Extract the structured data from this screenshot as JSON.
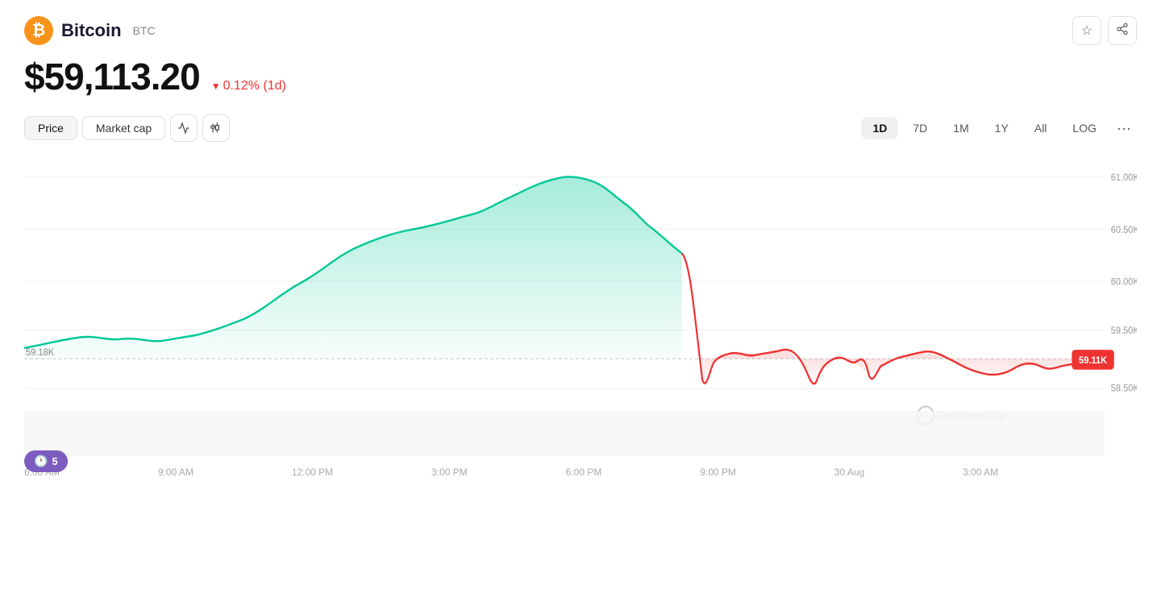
{
  "header": {
    "coin_name": "Bitcoin",
    "coin_symbol": "BTC",
    "price": "$59,113.20",
    "change": "0.12% (1d)",
    "change_direction": "down"
  },
  "tabs": {
    "price_label": "Price",
    "market_cap_label": "Market cap"
  },
  "time_filters": [
    {
      "label": "1D",
      "active": true
    },
    {
      "label": "7D",
      "active": false
    },
    {
      "label": "1M",
      "active": false
    },
    {
      "label": "1Y",
      "active": false
    },
    {
      "label": "All",
      "active": false
    },
    {
      "label": "LOG",
      "active": false
    }
  ],
  "chart": {
    "open_price": "59.18K",
    "current_price": "59.11K",
    "y_labels": [
      "61.00K",
      "60.50K",
      "60.00K",
      "59.50K",
      "59.18K",
      "58.50K"
    ],
    "x_labels": [
      "6:00 AM",
      "9:00 AM",
      "12:00 PM",
      "3:00 PM",
      "6:00 PM",
      "9:00 PM",
      "30 Aug",
      "3:00 AM"
    ]
  },
  "watermark": "CoinMarketCap",
  "bottom_badge": {
    "count": "5"
  },
  "icons": {
    "star": "☆",
    "share": "⤢",
    "line_chart": "╱",
    "candle": "⟜",
    "more": "•••"
  }
}
